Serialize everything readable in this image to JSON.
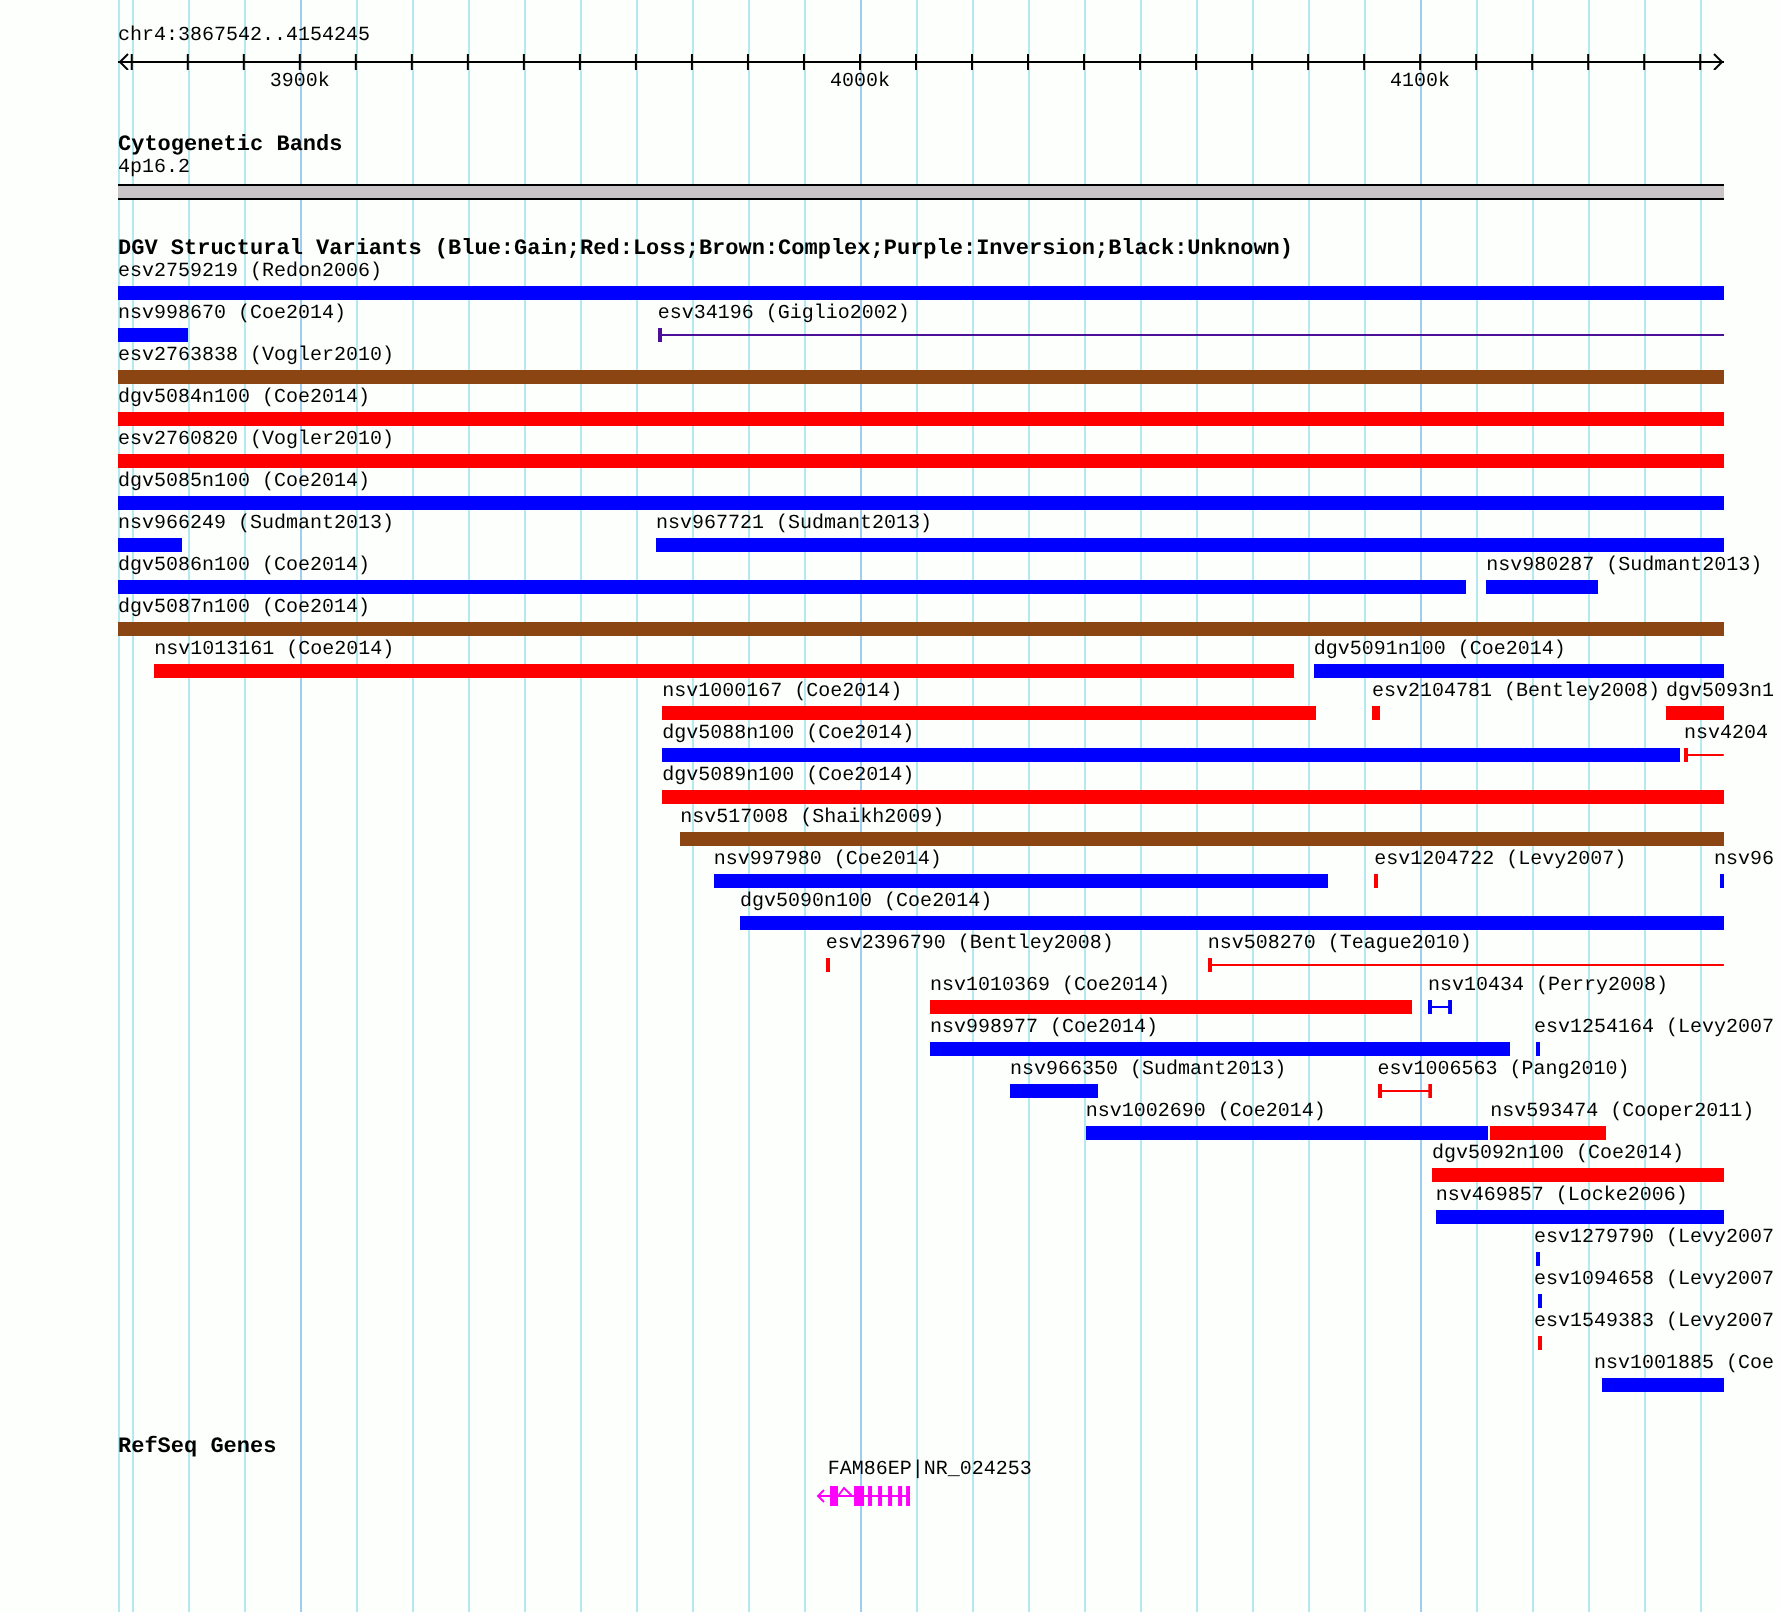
{
  "ruler": {
    "title": "chr4:3867542..4154245",
    "ticks": [
      {
        "label": "3900k"
      },
      {
        "label": "4000k"
      },
      {
        "label": "4100k"
      }
    ]
  },
  "cytobands": {
    "title": "Cytogenetic Bands",
    "band": "4p16.2"
  },
  "variants": {
    "title": "DGV Structural Variants (Blue:Gain;Red:Loss;Brown:Complex;Purple:Inversion;Black:Unknown)",
    "rows": [
      {
        "features": [
          {
            "label": "esv2759219 (Redon2006)",
            "color": "#0000ff",
            "kind": "bar"
          }
        ]
      },
      {
        "features": [
          {
            "label": "nsv998670 (Coe2014)",
            "color": "#0000ff",
            "kind": "bar"
          },
          {
            "label": "esv34196 (Giglio2002)",
            "color": "#4b0f99",
            "kind": "line"
          }
        ]
      },
      {
        "features": [
          {
            "label": "esv2763838 (Vogler2010)",
            "color": "#8b4513",
            "kind": "bar"
          }
        ]
      },
      {
        "features": [
          {
            "label": "dgv5084n100 (Coe2014)",
            "color": "#ff0000",
            "kind": "bar"
          }
        ]
      },
      {
        "features": [
          {
            "label": "esv2760820 (Vogler2010)",
            "color": "#ff0000",
            "kind": "bar"
          }
        ]
      },
      {
        "features": [
          {
            "label": "dgv5085n100 (Coe2014)",
            "color": "#0000ff",
            "kind": "bar"
          }
        ]
      },
      {
        "features": [
          {
            "label": "nsv966249 (Sudmant2013)",
            "color": "#0000ff",
            "kind": "bar"
          },
          {
            "label": "nsv967721 (Sudmant2013)",
            "color": "#0000ff",
            "kind": "bar"
          }
        ]
      },
      {
        "features": [
          {
            "label": "dgv5086n100 (Coe2014)",
            "color": "#0000ff",
            "kind": "bar"
          },
          {
            "label": "nsv980287 (Sudmant2013)",
            "color": "#0000ff",
            "kind": "bar"
          }
        ]
      },
      {
        "features": [
          {
            "label": "dgv5087n100 (Coe2014)",
            "color": "#8b4513",
            "kind": "bar"
          }
        ]
      },
      {
        "features": [
          {
            "label": "nsv1013161 (Coe2014)",
            "color": "#ff0000",
            "kind": "bar"
          },
          {
            "label": "dgv5091n100 (Coe2014)",
            "color": "#0000ff",
            "kind": "bar"
          }
        ]
      },
      {
        "features": [
          {
            "label": "nsv1000167 (Coe2014)",
            "color": "#ff0000",
            "kind": "bar"
          },
          {
            "label": "esv2104781 (Bentley2008)",
            "color": "#ff0000",
            "kind": "bar"
          },
          {
            "label": "dgv5093n1",
            "color": "#ff0000",
            "kind": "bar"
          }
        ]
      },
      {
        "features": [
          {
            "label": "dgv5088n100 (Coe2014)",
            "color": "#0000ff",
            "kind": "bar"
          },
          {
            "label": "nsv4204",
            "color": "#ff0000",
            "kind": "line"
          }
        ]
      },
      {
        "features": [
          {
            "label": "dgv5089n100 (Coe2014)",
            "color": "#ff0000",
            "kind": "bar"
          }
        ]
      },
      {
        "features": [
          {
            "label": "nsv517008 (Shaikh2009)",
            "color": "#8b4513",
            "kind": "bar"
          }
        ]
      },
      {
        "features": [
          {
            "label": "nsv997980 (Coe2014)",
            "color": "#0000ff",
            "kind": "bar"
          },
          {
            "label": "esv1204722 (Levy2007)",
            "color": "#ff0000",
            "kind": "bar"
          },
          {
            "label": "nsv96",
            "color": "#0000ff",
            "kind": "bar"
          }
        ]
      },
      {
        "features": [
          {
            "label": "dgv5090n100 (Coe2014)",
            "color": "#0000ff",
            "kind": "bar"
          }
        ]
      },
      {
        "features": [
          {
            "label": "esv2396790 (Bentley2008)",
            "color": "#ff0000",
            "kind": "bar"
          },
          {
            "label": "nsv508270 (Teague2010)",
            "color": "#ff0000",
            "kind": "line"
          }
        ]
      },
      {
        "features": [
          {
            "label": "nsv1010369 (Coe2014)",
            "color": "#ff0000",
            "kind": "bar"
          },
          {
            "label": "nsv10434 (Perry2008)",
            "color": "#0000ff",
            "kind": "interval"
          }
        ]
      },
      {
        "features": [
          {
            "label": "nsv998977 (Coe2014)",
            "color": "#0000ff",
            "kind": "bar"
          },
          {
            "label": "esv1254164 (Levy2007",
            "color": "#0000ff",
            "kind": "bar"
          }
        ]
      },
      {
        "features": [
          {
            "label": "nsv966350 (Sudmant2013)",
            "color": "#0000ff",
            "kind": "bar"
          },
          {
            "label": "esv1006563 (Pang2010)",
            "color": "#ff0000",
            "kind": "interval"
          }
        ]
      },
      {
        "features": [
          {
            "label": "nsv1002690 (Coe2014)",
            "color": "#0000ff",
            "kind": "bar"
          },
          {
            "label": "nsv593474 (Cooper2011)",
            "color": "#ff0000",
            "kind": "bar"
          }
        ]
      },
      {
        "features": [
          {
            "label": "dgv5092n100 (Coe2014)",
            "color": "#ff0000",
            "kind": "bar"
          }
        ]
      },
      {
        "features": [
          {
            "label": "nsv469857 (Locke2006)",
            "color": "#0000ff",
            "kind": "bar"
          }
        ]
      },
      {
        "features": [
          {
            "label": "esv1279790 (Levy2007",
            "color": "#0000ff",
            "kind": "bar"
          }
        ]
      },
      {
        "features": [
          {
            "label": "esv1094658 (Levy2007",
            "color": "#0000ff",
            "kind": "bar"
          }
        ]
      },
      {
        "features": [
          {
            "label": "esv1549383 (Levy2007",
            "color": "#ff0000",
            "kind": "bar"
          }
        ]
      },
      {
        "features": [
          {
            "label": "nsv1001885 (Coe",
            "color": "#0000ff",
            "kind": "bar"
          }
        ]
      }
    ]
  },
  "genes": {
    "title": "RefSeq Genes",
    "items": [
      {
        "label": "FAM86EP|NR_024253"
      }
    ]
  }
}
